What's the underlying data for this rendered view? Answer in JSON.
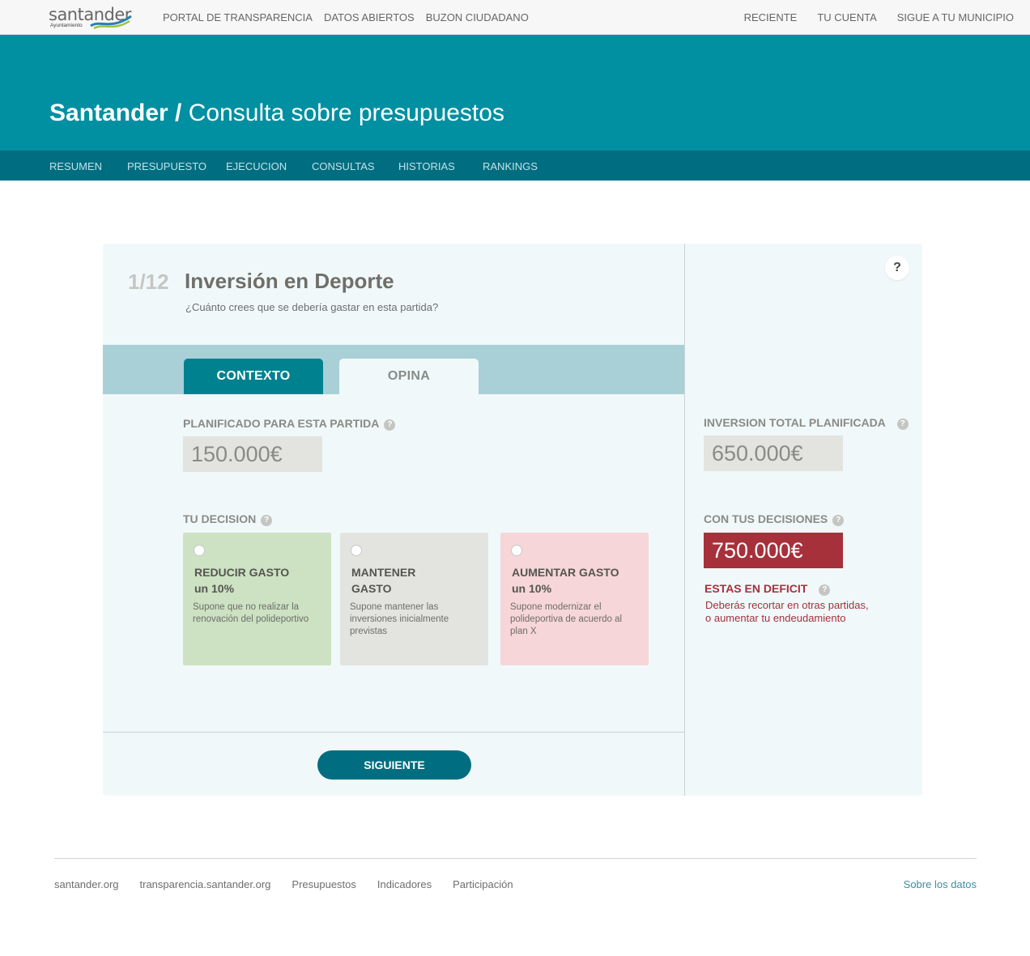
{
  "topbar": {
    "logo_text": "santander",
    "logo_sub": "Ayuntamiento",
    "nav_left": [
      "PORTAL DE TRANSPARENCIA",
      "DATOS ABIERTOS",
      "BUZON CIUDADANO"
    ],
    "nav_right": [
      "RECIENTE",
      "TU CUENTA",
      "SIGUE A TU MUNICIPIO"
    ]
  },
  "hero": {
    "city": "Santander /",
    "title": "Consulta sobre presupuestos"
  },
  "secnav": [
    "RESUMEN",
    "PRESUPUESTO",
    "EJECUCION",
    "CONSULTAS",
    "HISTORIAS",
    "RANKINGS"
  ],
  "question": {
    "step": "1/12",
    "title": "Inversión en Deporte",
    "subtitle": "¿Cuánto crees que se debería gastar en esta partida?",
    "help": "?"
  },
  "tabs": {
    "contexto": "CONTEXTO",
    "opina": "OPINA"
  },
  "planned": {
    "label": "PLANIFICADO PARA ESTA PARTIDA",
    "value": "150.000€"
  },
  "decision": {
    "label": "TU DECISION",
    "options": [
      {
        "title_1": "REDUCIR GASTO",
        "title_2": "un 10%",
        "desc": "Supone que no realizar la renovación del polideportivo"
      },
      {
        "title_1": "MANTENER",
        "title_2": "GASTO",
        "desc": "Supone mantener las inversiones inicialmente previstas"
      },
      {
        "title_1": "AUMENTAR GASTO",
        "title_2": "un 10%",
        "desc": "Supone modernizar el polideportiva de acuerdo al plan X"
      }
    ]
  },
  "next_button": "SIGUIENTE",
  "totals": {
    "planned_label": "INVERSION TOTAL PLANIFICADA",
    "planned_value": "650.000€",
    "yours_label": "CON TUS DECISIONES",
    "yours_value": "750.000€",
    "deficit_title": "ESTAS EN DEFICIT",
    "deficit_msg": "Deberás recortar en otras partidas,\no aumentar tu endeudamiento"
  },
  "footer": {
    "links": [
      "santander.org",
      "transparencia.santander.org",
      "Presupuestos",
      "Indicadores",
      "Participación"
    ],
    "right": "Sobre los datos"
  },
  "colors": {
    "hero": "#0090a1",
    "secnav": "#006e80",
    "accent": "#00818f",
    "deficit": "#a6313b",
    "option_reduce": "#cce2c3",
    "option_keep": "#e3e4e0",
    "option_increase": "#f6d6d9"
  },
  "icons": {
    "help": "question-circle-icon",
    "logo": "santander-wave-logo"
  }
}
